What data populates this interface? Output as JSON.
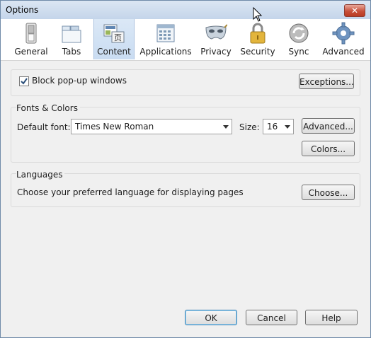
{
  "window": {
    "title": "Options",
    "close_glyph": "✕"
  },
  "tabs": [
    {
      "label": "General",
      "icon": "switch-icon"
    },
    {
      "label": "Tabs",
      "icon": "tabs-icon"
    },
    {
      "label": "Content",
      "icon": "content-icon",
      "selected": true
    },
    {
      "label": "Applications",
      "icon": "applications-icon"
    },
    {
      "label": "Privacy",
      "icon": "mask-icon"
    },
    {
      "label": "Security",
      "icon": "padlock-icon"
    },
    {
      "label": "Sync",
      "icon": "sync-icon"
    },
    {
      "label": "Advanced",
      "icon": "gear-icon"
    }
  ],
  "popups": {
    "checkbox_label": "Block pop-up windows",
    "checked": true,
    "exceptions_button": "Exceptions..."
  },
  "fonts": {
    "group_title": "Fonts & Colors",
    "default_font_label": "Default font:",
    "default_font_value": "Times New Roman",
    "size_label": "Size:",
    "size_value": "16",
    "advanced_button": "Advanced...",
    "colors_button": "Colors..."
  },
  "languages": {
    "group_title": "Languages",
    "description": "Choose your preferred language for displaying pages",
    "choose_button": "Choose..."
  },
  "footer": {
    "ok": "OK",
    "cancel": "Cancel",
    "help": "Help"
  },
  "colors": {
    "accent": "#3c7fb1",
    "selected_tab": "#c9dcf2",
    "close_button": "#c7503a"
  }
}
